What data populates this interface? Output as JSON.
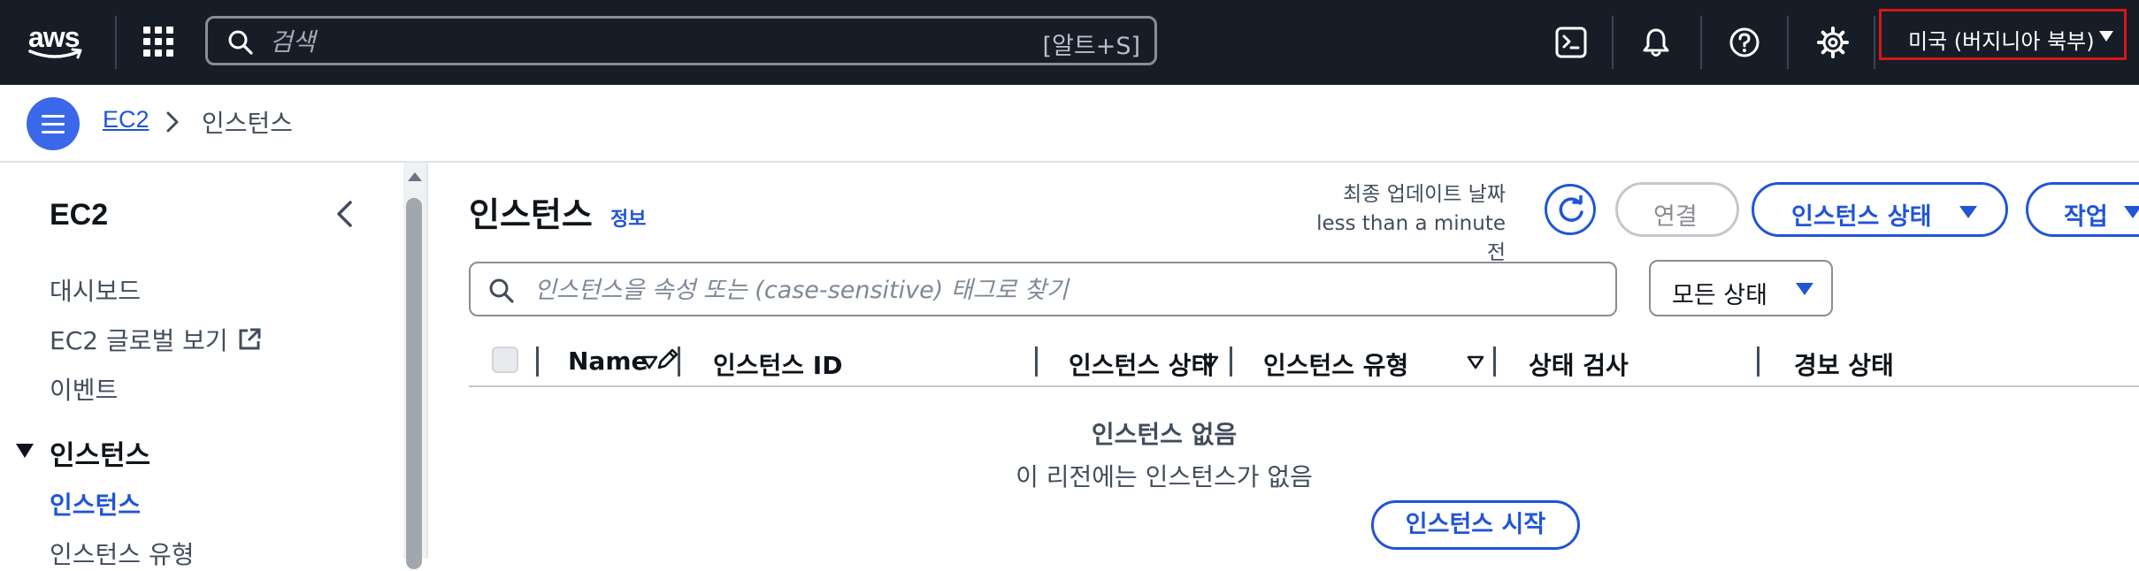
{
  "topnav": {
    "logo_text": "aws",
    "search_placeholder": "검색",
    "search_shortcut": "[알트+S]",
    "icons": [
      "apps-grid-icon",
      "cloudshell-icon",
      "bell-icon",
      "help-icon",
      "gear-icon"
    ],
    "region_label": "미국 (버지니아 북부)"
  },
  "breadcrumb": {
    "items": [
      "EC2",
      "인스턴스"
    ]
  },
  "sidebar": {
    "title": "EC2",
    "items": [
      "대시보드",
      "EC2 글로벌 보기",
      "이벤트"
    ],
    "section": "인스턴스",
    "section_items": [
      "인스턴스",
      "인스턴스 유형"
    ],
    "active_item": "인스턴스"
  },
  "main": {
    "title": "인스턴스",
    "info_link": "정보",
    "updated_label": "최종 업데이트 날짜",
    "updated_value": "less than a minute 전",
    "connect_button": "연결",
    "state_button": "인스턴스 상태",
    "actions_button": "작업",
    "filter_placeholder": "인스턴스을 속성 또는 (case-sensitive) 태그로 찾기",
    "state_filter": "모든 상태",
    "columns": [
      "Name",
      "인스턴스 ID",
      "인스턴스 상태",
      "인스턴스 유형",
      "상태 검사",
      "경보 상태"
    ],
    "empty_title": "인스턴스 없음",
    "empty_desc": "이 리전에는 인스턴스가 없음",
    "launch_button": "인스턴스 시작"
  },
  "colors": {
    "nav_bg": "#161d26",
    "accent": "#2055d6",
    "menu_button": "#3b68e8",
    "region_border": "#d91515"
  }
}
